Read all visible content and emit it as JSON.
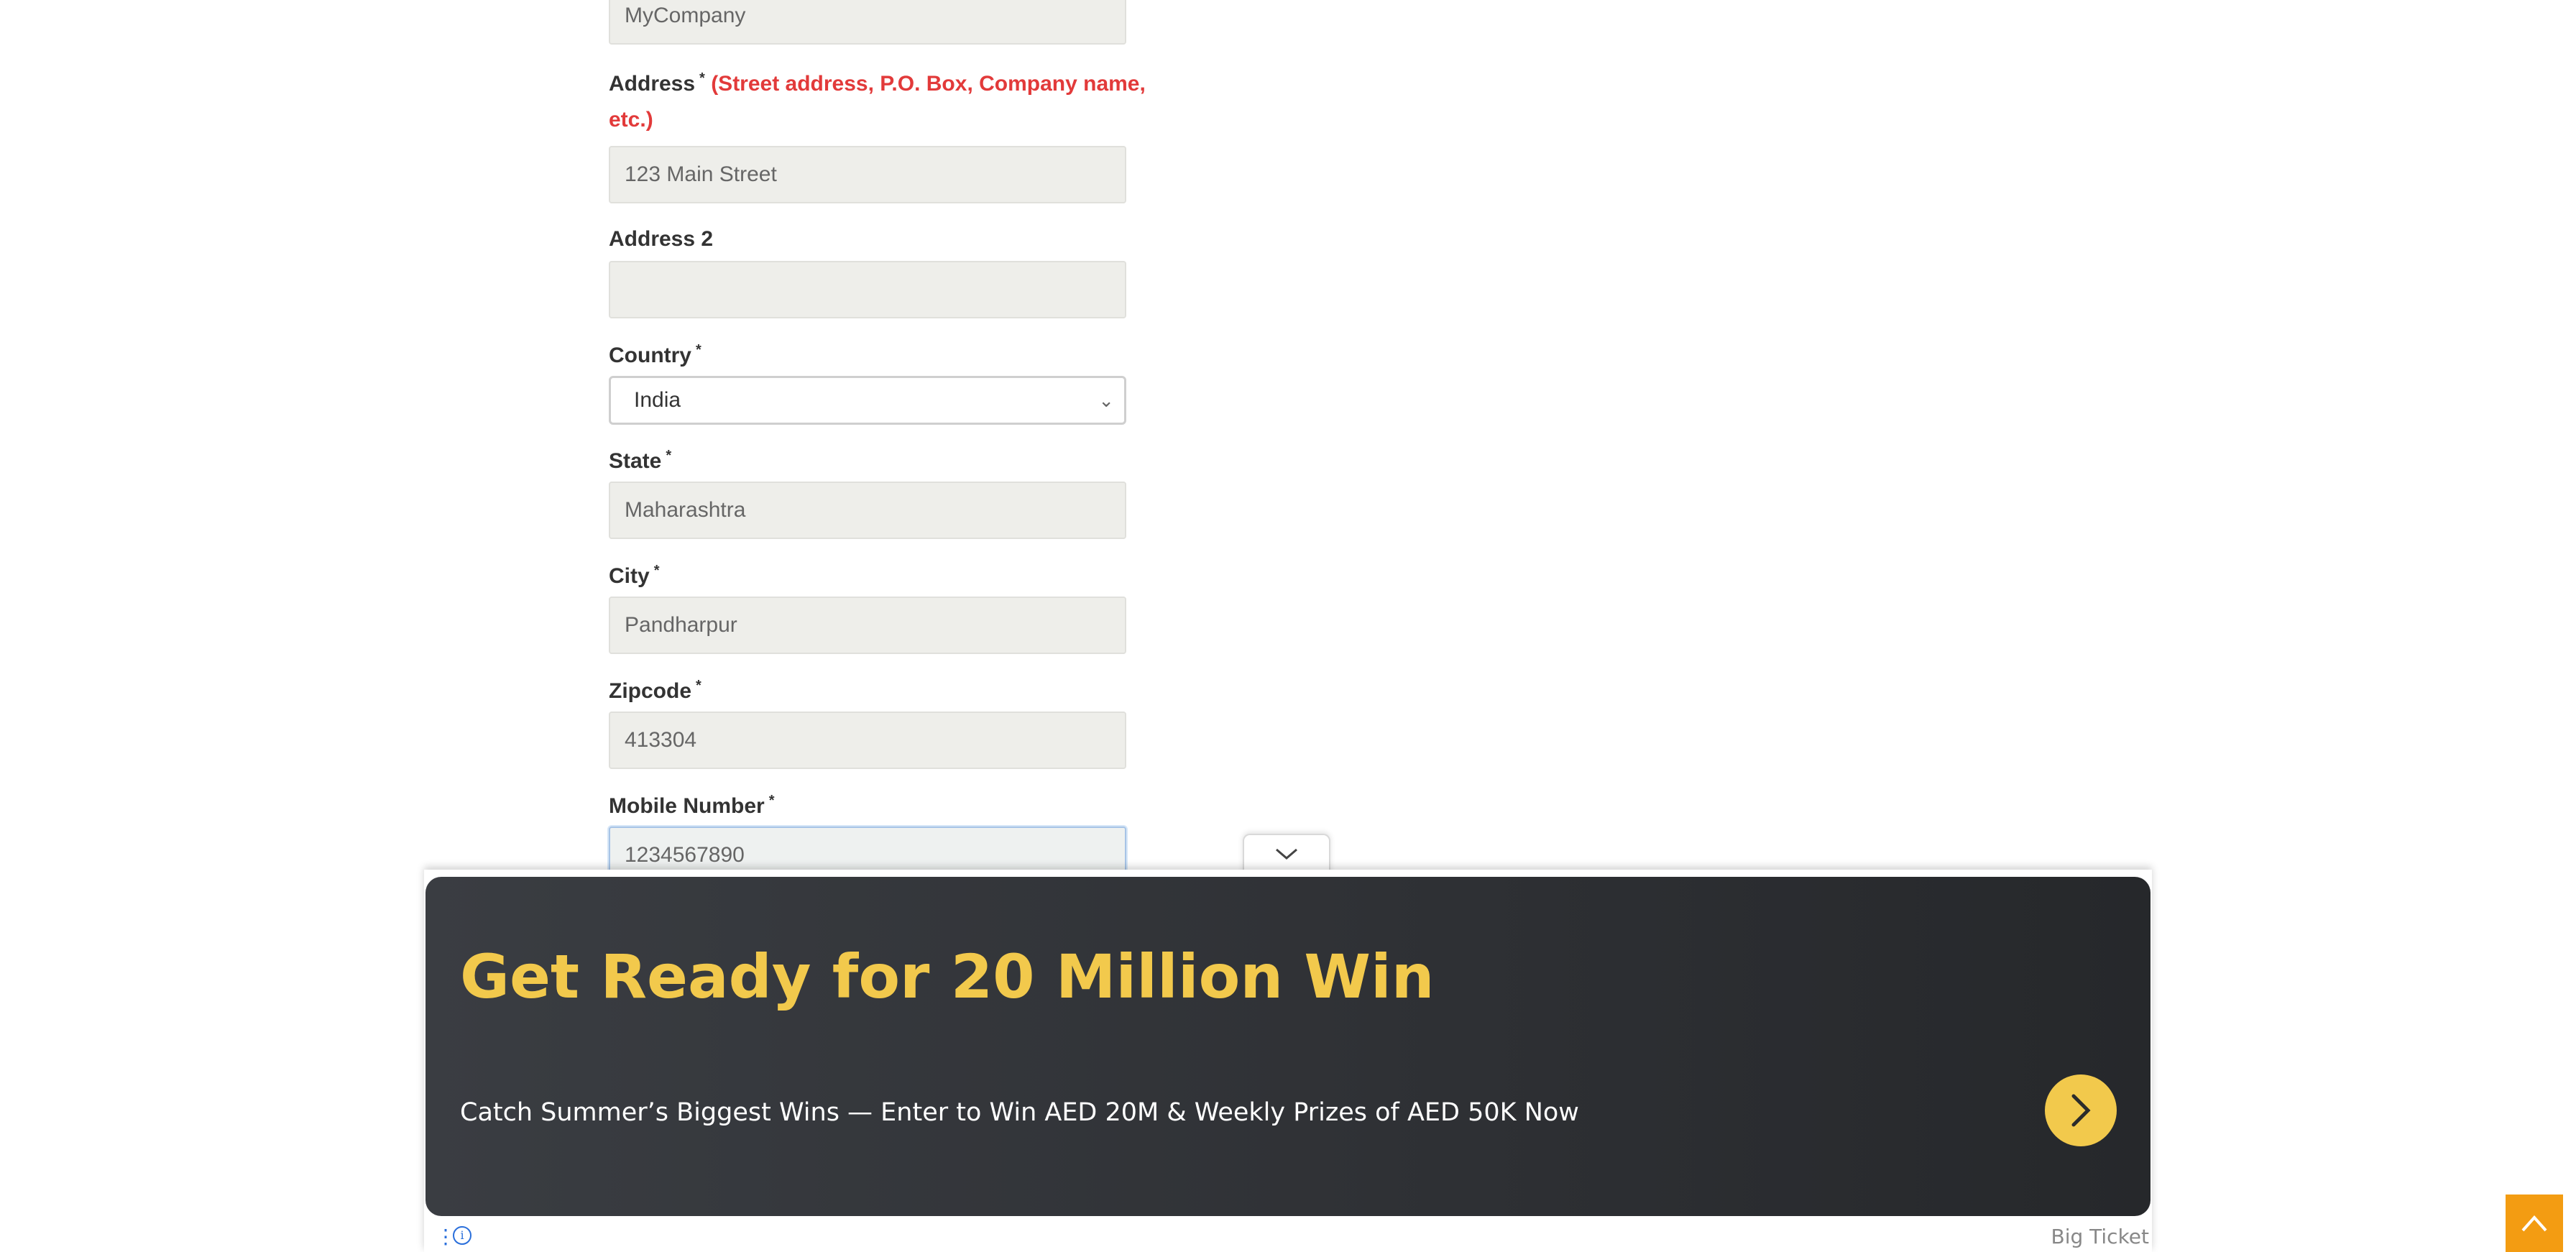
{
  "form": {
    "company": {
      "value": "MyCompany"
    },
    "address": {
      "label": "Address",
      "required": "*",
      "hint": "(Street address, P.O. Box, Company name,",
      "hint_cont": "etc.)",
      "value": "123 Main Street"
    },
    "address2": {
      "label": "Address 2",
      "value": ""
    },
    "country": {
      "label": "Country",
      "required": "*",
      "value": "India"
    },
    "state": {
      "label": "State",
      "required": "*",
      "value": "Maharashtra"
    },
    "city": {
      "label": "City",
      "required": "*",
      "value": "Pandharpur"
    },
    "zipcode": {
      "label": "Zipcode",
      "required": "*",
      "value": "413304"
    },
    "mobile": {
      "label": "Mobile Number",
      "required": "*",
      "value": "1234567890"
    }
  },
  "ad": {
    "title": "Get Ready for 20 Million Win",
    "body": "Catch Summer’s Biggest Wins — Enter to Win AED 20M & Weekly Prizes of AED 50K Now",
    "sponsor": "Big Ticket",
    "info_icon": "i",
    "menu_icon": "⋮",
    "accent_color": "#f2c94c"
  },
  "scroll_top": {
    "icon": "chevron-up-icon",
    "color": "#f39c12"
  }
}
